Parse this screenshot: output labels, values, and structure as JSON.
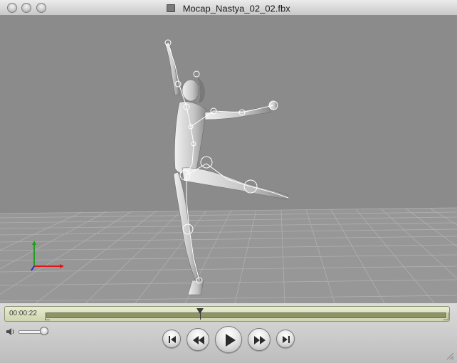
{
  "window": {
    "title": "Mocap_Nastya_02_02.fbx",
    "title_icon": "fbx-file-icon"
  },
  "viewport": {
    "background_color": "#8a8a8a",
    "floor_grid_color": "#b4b4b4",
    "figure_color": "#d2d2d2",
    "axis_colors": {
      "x": "#e01818",
      "y": "#1ea01e",
      "z": "#1a2ad8"
    }
  },
  "controller": {
    "timecode": "00:00:22",
    "playhead_fraction": 0.385,
    "volume_fraction": 0.9,
    "timeline_color": "#d9dfb9",
    "icons": {
      "speaker": "speaker-icon",
      "go_to_start": "skip-to-start-icon",
      "rewind": "rewind-icon",
      "play": "play-icon",
      "fast_forward": "fast-forward-icon",
      "go_to_end": "skip-to-end-icon"
    }
  }
}
